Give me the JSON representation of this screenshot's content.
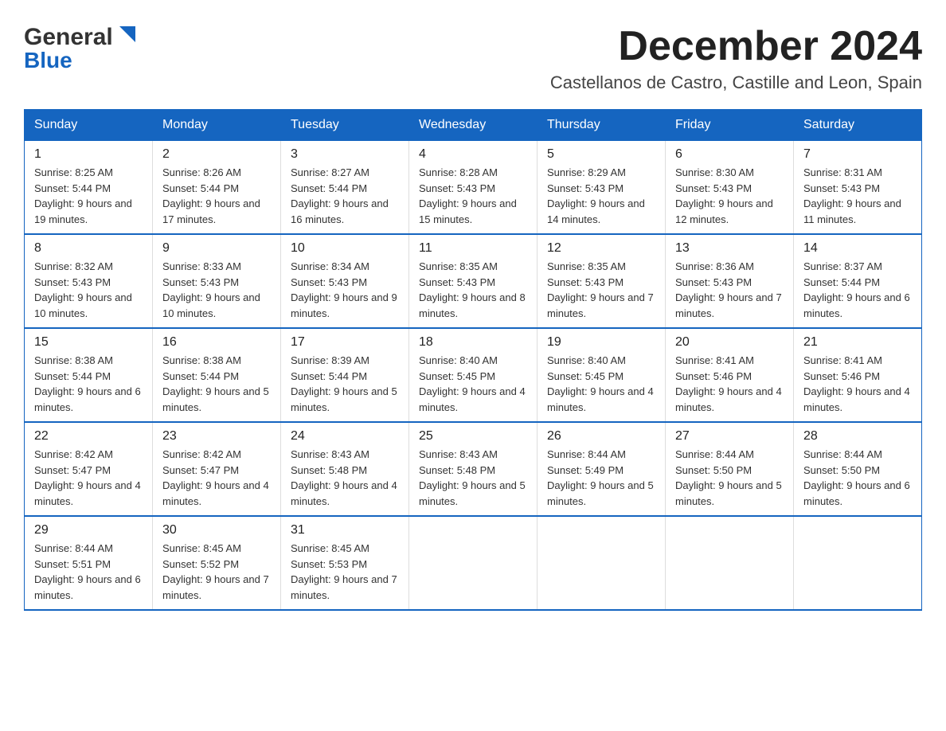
{
  "header": {
    "logo_text_general": "General",
    "logo_text_blue": "Blue",
    "month_title": "December 2024",
    "location": "Castellanos de Castro, Castille and Leon, Spain"
  },
  "weekdays": [
    "Sunday",
    "Monday",
    "Tuesday",
    "Wednesday",
    "Thursday",
    "Friday",
    "Saturday"
  ],
  "weeks": [
    [
      {
        "day": "1",
        "sunrise": "8:25 AM",
        "sunset": "5:44 PM",
        "daylight": "9 hours and 19 minutes."
      },
      {
        "day": "2",
        "sunrise": "8:26 AM",
        "sunset": "5:44 PM",
        "daylight": "9 hours and 17 minutes."
      },
      {
        "day": "3",
        "sunrise": "8:27 AM",
        "sunset": "5:44 PM",
        "daylight": "9 hours and 16 minutes."
      },
      {
        "day": "4",
        "sunrise": "8:28 AM",
        "sunset": "5:43 PM",
        "daylight": "9 hours and 15 minutes."
      },
      {
        "day": "5",
        "sunrise": "8:29 AM",
        "sunset": "5:43 PM",
        "daylight": "9 hours and 14 minutes."
      },
      {
        "day": "6",
        "sunrise": "8:30 AM",
        "sunset": "5:43 PM",
        "daylight": "9 hours and 12 minutes."
      },
      {
        "day": "7",
        "sunrise": "8:31 AM",
        "sunset": "5:43 PM",
        "daylight": "9 hours and 11 minutes."
      }
    ],
    [
      {
        "day": "8",
        "sunrise": "8:32 AM",
        "sunset": "5:43 PM",
        "daylight": "9 hours and 10 minutes."
      },
      {
        "day": "9",
        "sunrise": "8:33 AM",
        "sunset": "5:43 PM",
        "daylight": "9 hours and 10 minutes."
      },
      {
        "day": "10",
        "sunrise": "8:34 AM",
        "sunset": "5:43 PM",
        "daylight": "9 hours and 9 minutes."
      },
      {
        "day": "11",
        "sunrise": "8:35 AM",
        "sunset": "5:43 PM",
        "daylight": "9 hours and 8 minutes."
      },
      {
        "day": "12",
        "sunrise": "8:35 AM",
        "sunset": "5:43 PM",
        "daylight": "9 hours and 7 minutes."
      },
      {
        "day": "13",
        "sunrise": "8:36 AM",
        "sunset": "5:43 PM",
        "daylight": "9 hours and 7 minutes."
      },
      {
        "day": "14",
        "sunrise": "8:37 AM",
        "sunset": "5:44 PM",
        "daylight": "9 hours and 6 minutes."
      }
    ],
    [
      {
        "day": "15",
        "sunrise": "8:38 AM",
        "sunset": "5:44 PM",
        "daylight": "9 hours and 6 minutes."
      },
      {
        "day": "16",
        "sunrise": "8:38 AM",
        "sunset": "5:44 PM",
        "daylight": "9 hours and 5 minutes."
      },
      {
        "day": "17",
        "sunrise": "8:39 AM",
        "sunset": "5:44 PM",
        "daylight": "9 hours and 5 minutes."
      },
      {
        "day": "18",
        "sunrise": "8:40 AM",
        "sunset": "5:45 PM",
        "daylight": "9 hours and 4 minutes."
      },
      {
        "day": "19",
        "sunrise": "8:40 AM",
        "sunset": "5:45 PM",
        "daylight": "9 hours and 4 minutes."
      },
      {
        "day": "20",
        "sunrise": "8:41 AM",
        "sunset": "5:46 PM",
        "daylight": "9 hours and 4 minutes."
      },
      {
        "day": "21",
        "sunrise": "8:41 AM",
        "sunset": "5:46 PM",
        "daylight": "9 hours and 4 minutes."
      }
    ],
    [
      {
        "day": "22",
        "sunrise": "8:42 AM",
        "sunset": "5:47 PM",
        "daylight": "9 hours and 4 minutes."
      },
      {
        "day": "23",
        "sunrise": "8:42 AM",
        "sunset": "5:47 PM",
        "daylight": "9 hours and 4 minutes."
      },
      {
        "day": "24",
        "sunrise": "8:43 AM",
        "sunset": "5:48 PM",
        "daylight": "9 hours and 4 minutes."
      },
      {
        "day": "25",
        "sunrise": "8:43 AM",
        "sunset": "5:48 PM",
        "daylight": "9 hours and 5 minutes."
      },
      {
        "day": "26",
        "sunrise": "8:44 AM",
        "sunset": "5:49 PM",
        "daylight": "9 hours and 5 minutes."
      },
      {
        "day": "27",
        "sunrise": "8:44 AM",
        "sunset": "5:50 PM",
        "daylight": "9 hours and 5 minutes."
      },
      {
        "day": "28",
        "sunrise": "8:44 AM",
        "sunset": "5:50 PM",
        "daylight": "9 hours and 6 minutes."
      }
    ],
    [
      {
        "day": "29",
        "sunrise": "8:44 AM",
        "sunset": "5:51 PM",
        "daylight": "9 hours and 6 minutes."
      },
      {
        "day": "30",
        "sunrise": "8:45 AM",
        "sunset": "5:52 PM",
        "daylight": "9 hours and 7 minutes."
      },
      {
        "day": "31",
        "sunrise": "8:45 AM",
        "sunset": "5:53 PM",
        "daylight": "9 hours and 7 minutes."
      },
      null,
      null,
      null,
      null
    ]
  ]
}
